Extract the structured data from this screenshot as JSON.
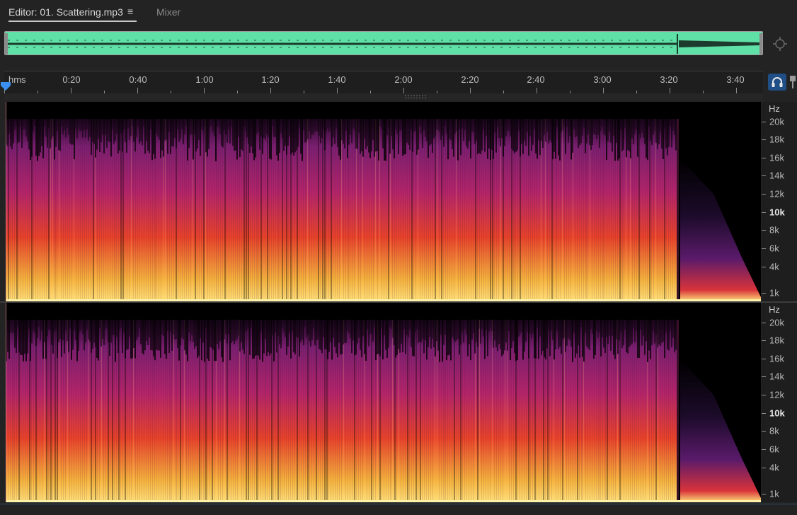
{
  "tabs": {
    "editor_label": "Editor: 01. Scattering.mp3",
    "menu_glyph": "≡",
    "mixer_label": "Mixer"
  },
  "ruler": {
    "unit": "hms",
    "labels": [
      "0:20",
      "0:40",
      "1:00",
      "1:20",
      "1:40",
      "2:00",
      "2:20",
      "2:40",
      "3:00",
      "3:20",
      "3:40"
    ]
  },
  "spectral": {
    "unit": "Hz",
    "ticks": [
      "20k",
      "18k",
      "16k",
      "14k",
      "12k",
      "10k",
      "8k",
      "6k",
      "4k",
      "1k"
    ],
    "bold_tick": "10k"
  },
  "icons": {
    "zoom": "zoom-to-selection-icon",
    "headphones": "headphones-icon",
    "pin": "pin-icon",
    "menu": "menu-icon"
  },
  "colors": {
    "waveform": "#5fe0a6",
    "accent": "#1f6fc4",
    "spec_low": "#ffe07a",
    "spec_mid": "#e8432a",
    "spec_high": "#7a1f70"
  }
}
